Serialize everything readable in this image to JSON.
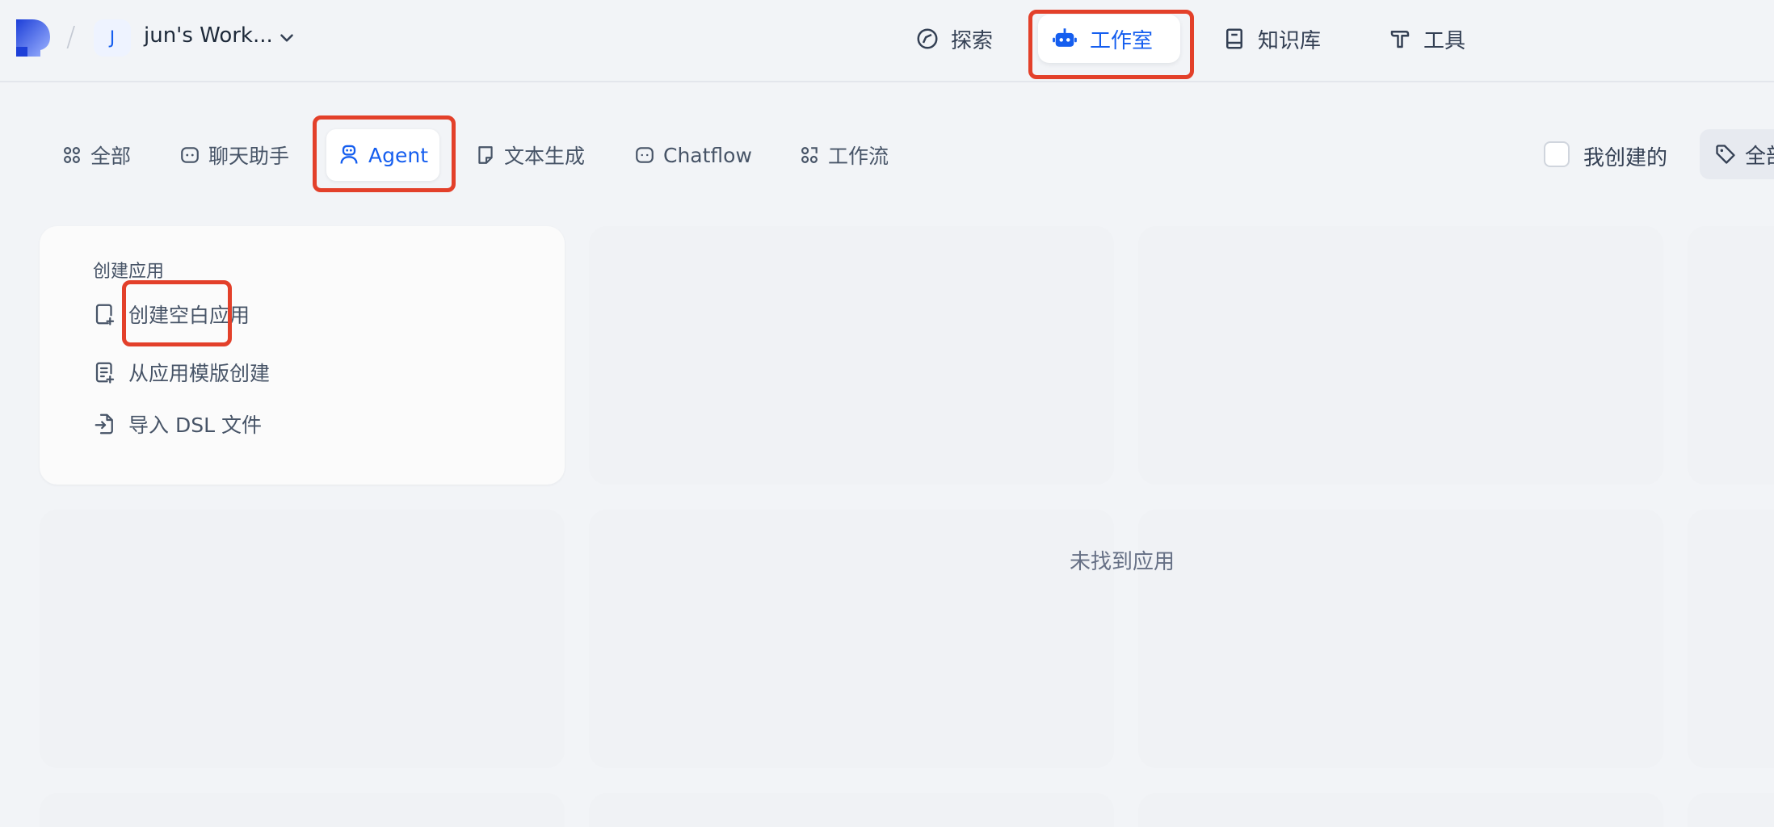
{
  "header": {
    "workspace_initial": "J",
    "workspace_name": "jun's Work...",
    "nav": [
      {
        "label": "探索",
        "icon": "compass-icon"
      },
      {
        "label": "工作室",
        "icon": "robot-icon",
        "active": true
      },
      {
        "label": "知识库",
        "icon": "book-icon"
      },
      {
        "label": "工具",
        "icon": "hammer-icon"
      }
    ]
  },
  "filters": {
    "tabs": [
      {
        "label": "全部",
        "icon": "grid-icon"
      },
      {
        "label": "聊天助手",
        "icon": "chat-bot-icon"
      },
      {
        "label": "Agent",
        "icon": "agent-icon",
        "active": true
      },
      {
        "label": "文本生成",
        "icon": "note-icon"
      },
      {
        "label": "Chatflow",
        "icon": "chatflow-icon"
      },
      {
        "label": "工作流",
        "icon": "workflow-icon"
      }
    ],
    "mine_label": "我创建的",
    "mine_checked": false,
    "tag_label": "全部标签"
  },
  "create_card": {
    "title": "创建应用",
    "items": [
      {
        "label": "创建空白应用",
        "icon": "blank-file-plus-icon"
      },
      {
        "label": "从应用模版创建",
        "icon": "template-file-icon"
      },
      {
        "label": "导入 DSL 文件",
        "icon": "file-import-icon"
      }
    ]
  },
  "empty_state": "未找到应用",
  "colors": {
    "accent": "#155eef",
    "highlight": "#e3402a",
    "background": "#f2f4f7"
  }
}
